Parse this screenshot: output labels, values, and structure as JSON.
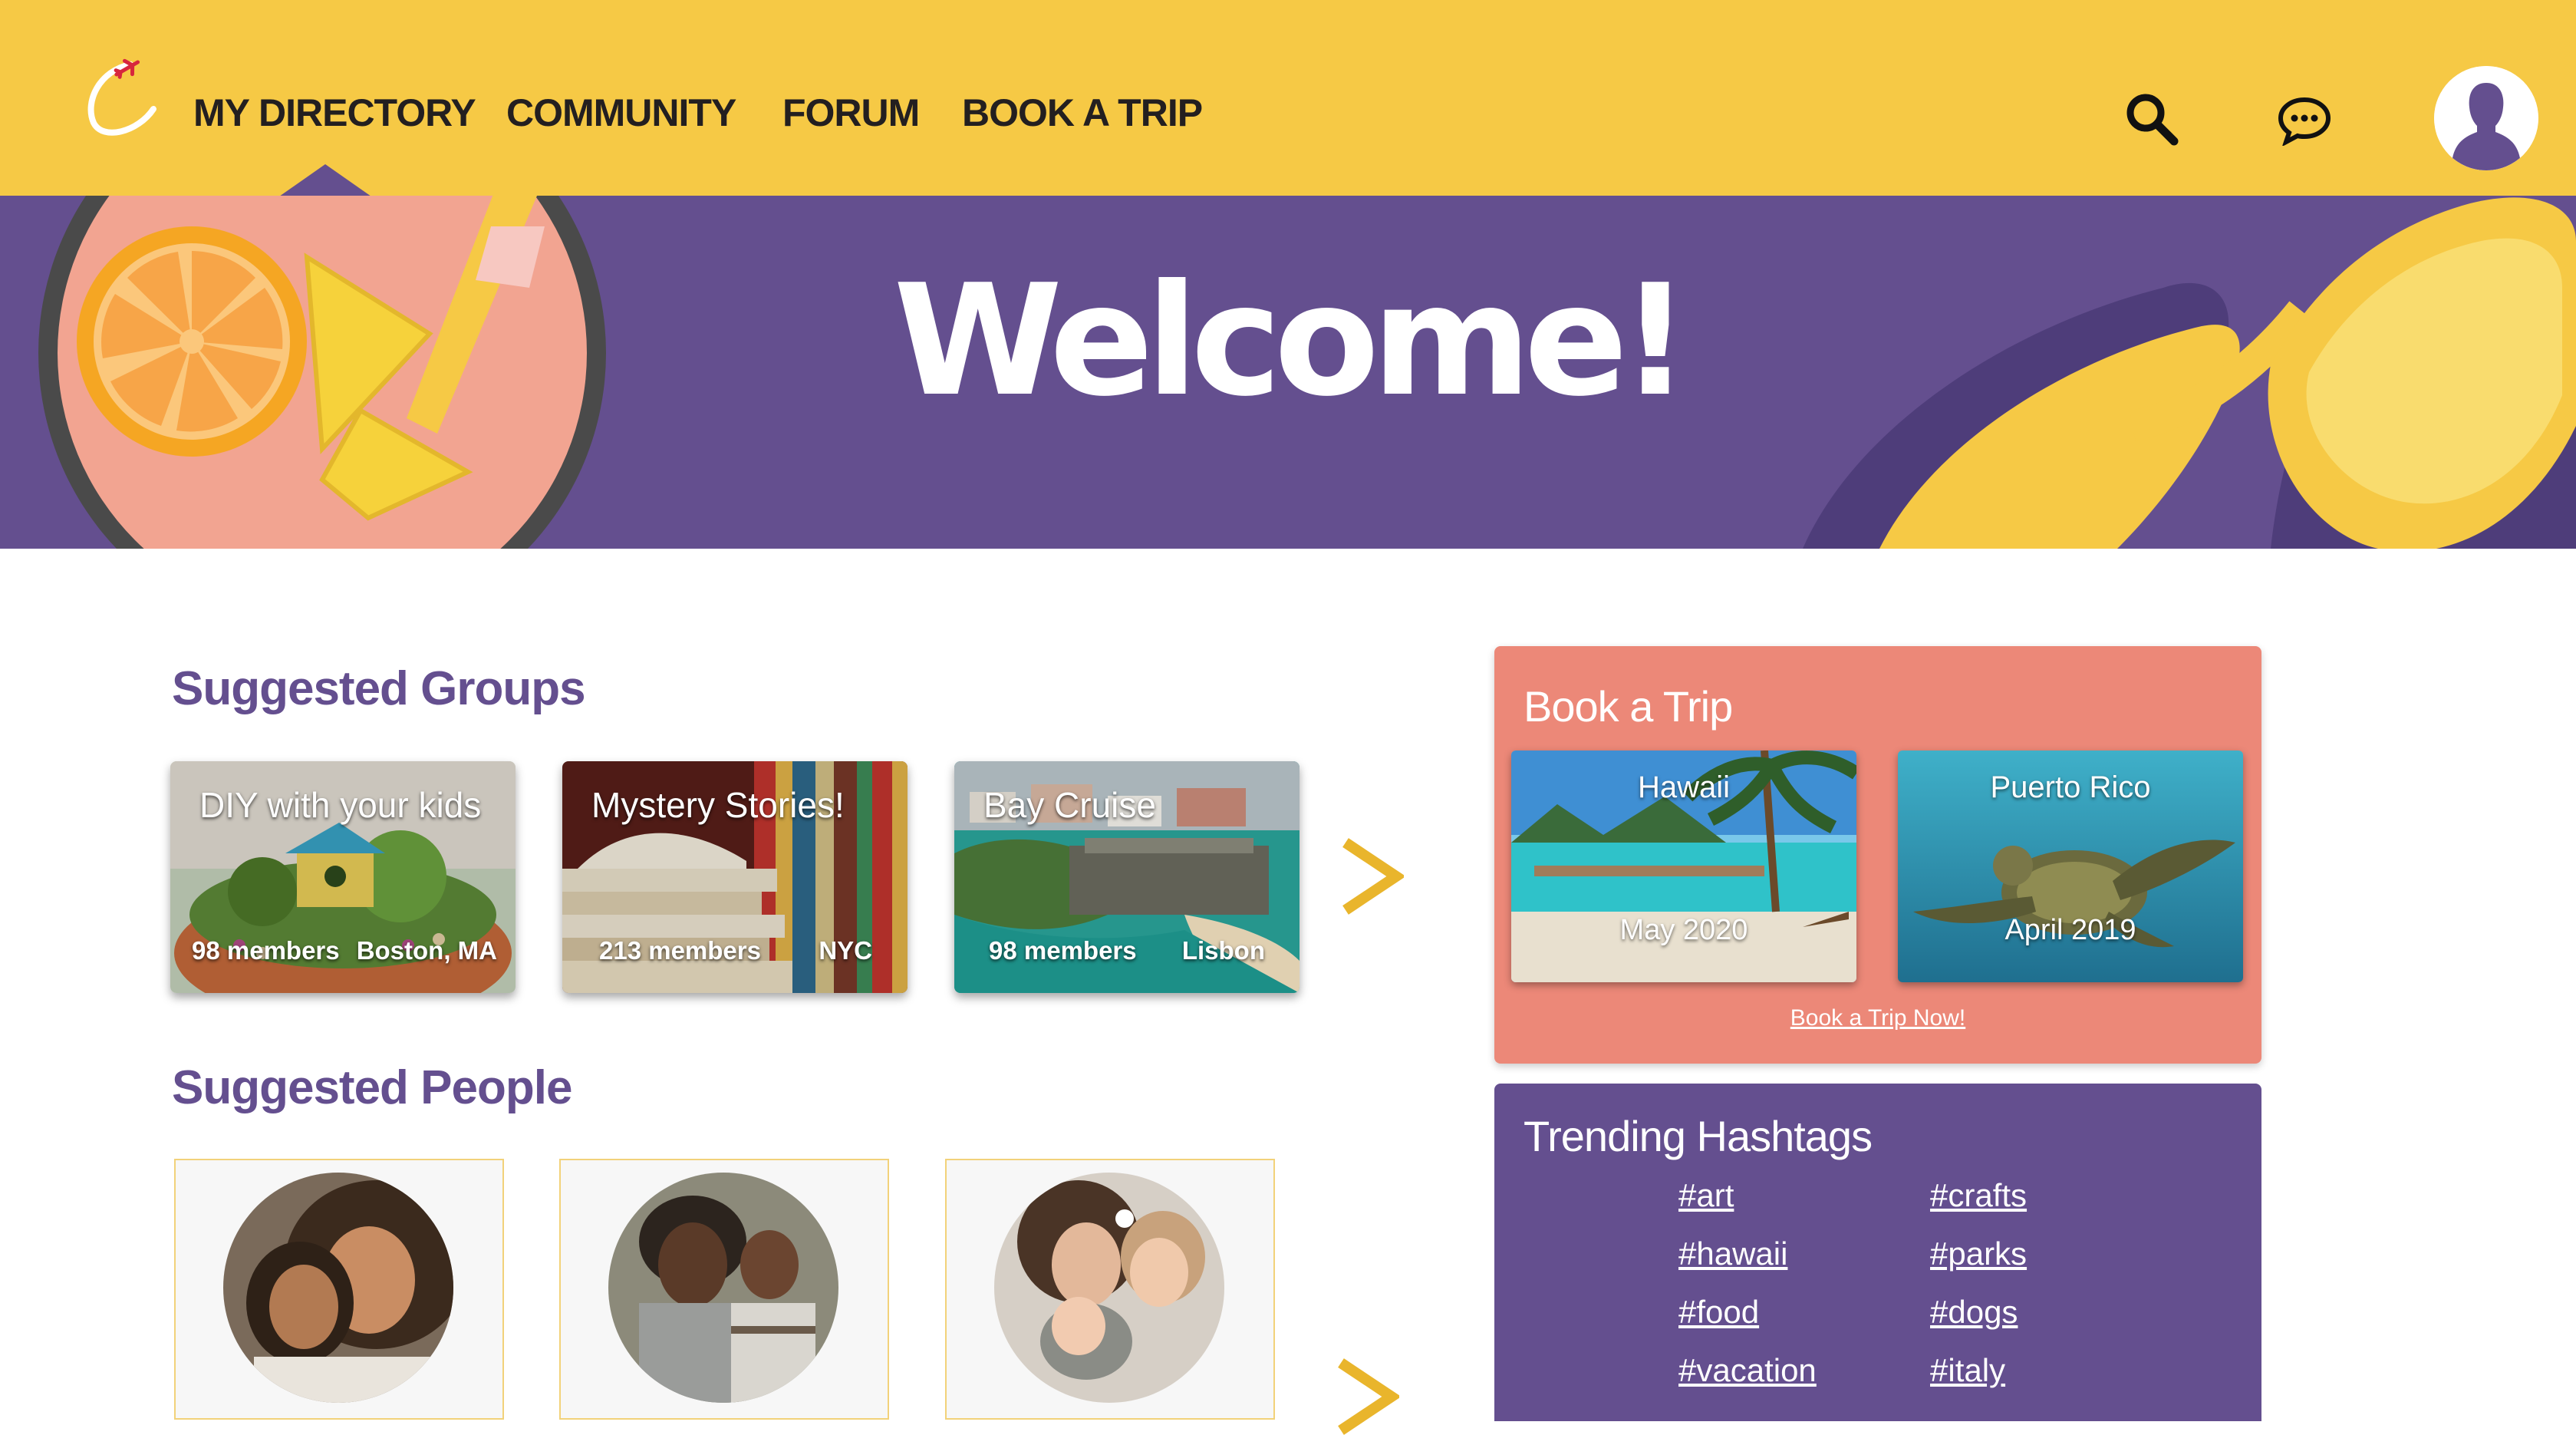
{
  "header": {
    "logo": "plane-swoosh-logo",
    "nav": [
      "MY DIRECTORY",
      "COMMUNITY",
      "FORUM",
      "BOOK A TRIP"
    ],
    "active_nav": "MY DIRECTORY",
    "icons": [
      "search-icon",
      "chat-icon",
      "avatar"
    ]
  },
  "banner": {
    "title": "Welcome!"
  },
  "suggested_groups": {
    "title": "Suggested Groups",
    "items": [
      {
        "name": "DIY with your kids",
        "members": "98 members",
        "location": "Boston, MA"
      },
      {
        "name": "Mystery Stories!",
        "members": "213 members",
        "location": "NYC"
      },
      {
        "name": "Bay Cruise",
        "members": "98 members",
        "location": "Lisbon"
      }
    ]
  },
  "suggested_people": {
    "title": "Suggested People"
  },
  "book_trip": {
    "title": "Book a Trip",
    "trips": [
      {
        "name": "Hawaii",
        "date": "May 2020"
      },
      {
        "name": "Puerto Rico",
        "date": "April 2019"
      }
    ],
    "link": "Book a Trip Now!"
  },
  "trending": {
    "title": "Trending Hashtags",
    "tags": [
      "#art",
      "#crafts",
      "#hawaii",
      "#parks",
      "#food",
      "#dogs",
      "#vacation",
      "#italy"
    ]
  },
  "colors": {
    "header_yellow": "#f6c945",
    "brand_purple": "#644f8f",
    "trip_coral": "#ec8878",
    "accent_gold": "#e9b52c"
  }
}
